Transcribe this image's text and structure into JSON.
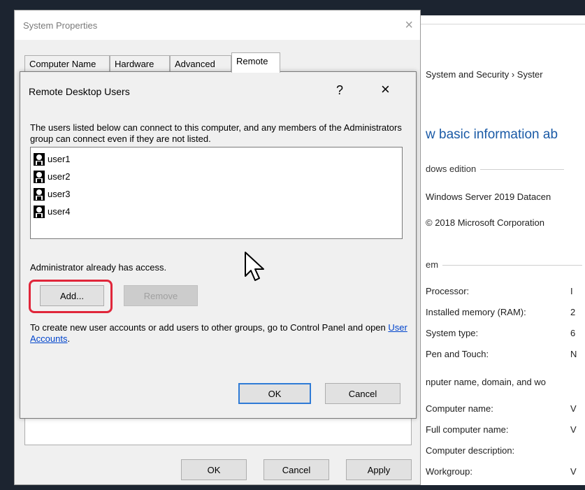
{
  "background_window": {
    "breadcrumb": "System and Security  ›  Syster",
    "heading": "w basic information ab",
    "edition_label": "dows edition",
    "edition_value": "Windows Server 2019 Datacen",
    "copyright": "© 2018 Microsoft Corporation",
    "system_label": "em",
    "processor_label": "Processor:",
    "processor_value": "I",
    "ram_label": "Installed memory (RAM):",
    "ram_value": "2",
    "systype_label": "System type:",
    "systype_value": "6",
    "pen_label": "Pen and Touch:",
    "pen_value": "N",
    "computer_section": "nputer name, domain, and wo",
    "compname_label": "Computer name:",
    "compname_value": "V",
    "fullname_label": "Full computer name:",
    "fullname_value": "V",
    "desc_label": "Computer description:",
    "workgroup_label": "Workgroup:",
    "workgroup_value": "V"
  },
  "system_properties": {
    "title": "System Properties",
    "close": "×",
    "tabs": [
      "Computer Name",
      "Hardware",
      "Advanced",
      "Remote"
    ],
    "active_tab": "Remote",
    "ok_label": "OK",
    "cancel_label": "Cancel",
    "apply_label": "Apply"
  },
  "rdu_dialog": {
    "title": "Remote Desktop Users",
    "help": "?",
    "close": "×",
    "description": "The users listed below can connect to this computer, and any members of the Administrators group can connect even if they are not listed.",
    "users": [
      "user1",
      "user2",
      "user3",
      "user4"
    ],
    "admin_note": "Administrator already has access.",
    "add_label": "Add...",
    "remove_label": "Remove",
    "info_prefix": "To create new user accounts or add users to other groups, go to Control Panel and open ",
    "info_link": "User Accounts",
    "info_suffix": ".",
    "ok_label": "OK",
    "cancel_label": "Cancel"
  },
  "colors": {
    "highlight": "#e0263a",
    "link": "#0044cc",
    "heading": "#1a5aa6"
  }
}
